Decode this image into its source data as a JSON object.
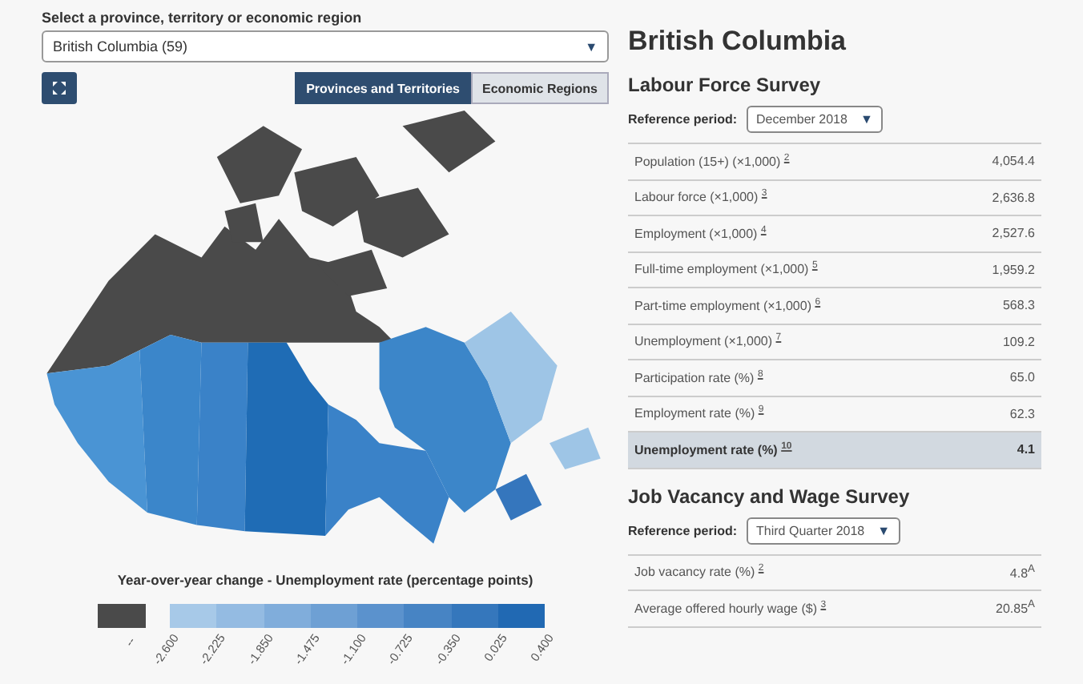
{
  "selector": {
    "label": "Select a province, territory or economic region",
    "value": "British Columbia (59)",
    "arrow": "▼"
  },
  "view_tabs": [
    {
      "label": "Provinces and Territories",
      "selected": true
    },
    {
      "label": "Economic Regions",
      "selected": false
    }
  ],
  "legend": {
    "title": "Year-over-year change - Unemployment rate (percentage points)",
    "no_data": {
      "label": "--",
      "color": "#4a4a4a"
    },
    "bins": [
      {
        "color": "#a7c9e8"
      },
      {
        "color": "#94bbe2"
      },
      {
        "color": "#80addb"
      },
      {
        "color": "#6ea0d4"
      },
      {
        "color": "#5b92cd"
      },
      {
        "color": "#4784c4"
      },
      {
        "color": "#3577bc"
      },
      {
        "color": "#2169b3"
      }
    ],
    "ticks": [
      "-2.600",
      "-2.225",
      "-1.850",
      "-1.475",
      "-1.100",
      "-0.725",
      "-0.350",
      "0.025",
      "0.400"
    ]
  },
  "region_title": "British Columbia",
  "labour_force_survey": {
    "title": "Labour Force Survey",
    "period_label": "Reference period:",
    "period": "December 2018",
    "arrow": "▼",
    "rows": [
      {
        "label": "Population (15+) (×1,000)",
        "note": "2",
        "value": "4,054.4",
        "highlighted": false
      },
      {
        "label": "Labour force (×1,000)",
        "note": "3",
        "value": "2,636.8",
        "highlighted": false
      },
      {
        "label": "Employment (×1,000)",
        "note": "4",
        "value": "2,527.6",
        "highlighted": false
      },
      {
        "label": "Full-time employment (×1,000)",
        "note": "5",
        "value": "1,959.2",
        "highlighted": false
      },
      {
        "label": "Part-time employment (×1,000)",
        "note": "6",
        "value": "568.3",
        "highlighted": false
      },
      {
        "label": "Unemployment (×1,000)",
        "note": "7",
        "value": "109.2",
        "highlighted": false
      },
      {
        "label": "Participation rate (%)",
        "note": "8",
        "value": "65.0",
        "highlighted": false
      },
      {
        "label": "Employment rate (%)",
        "note": "9",
        "value": "62.3",
        "highlighted": false
      },
      {
        "label": "Unemployment rate (%)",
        "note": "10",
        "value": "4.1",
        "highlighted": true
      }
    ]
  },
  "job_vacancy_survey": {
    "title": "Job Vacancy and Wage Survey",
    "period_label": "Reference period:",
    "period": "Third Quarter 2018",
    "arrow": "▼",
    "rows": [
      {
        "label": "Job vacancy rate (%)",
        "note": "2",
        "value": "4.8$^{A}$",
        "highlighted": false
      },
      {
        "label": "Average offered hourly wage ($)",
        "note": "3",
        "value": "20.85$^{A}$",
        "highlighted": false
      }
    ]
  }
}
